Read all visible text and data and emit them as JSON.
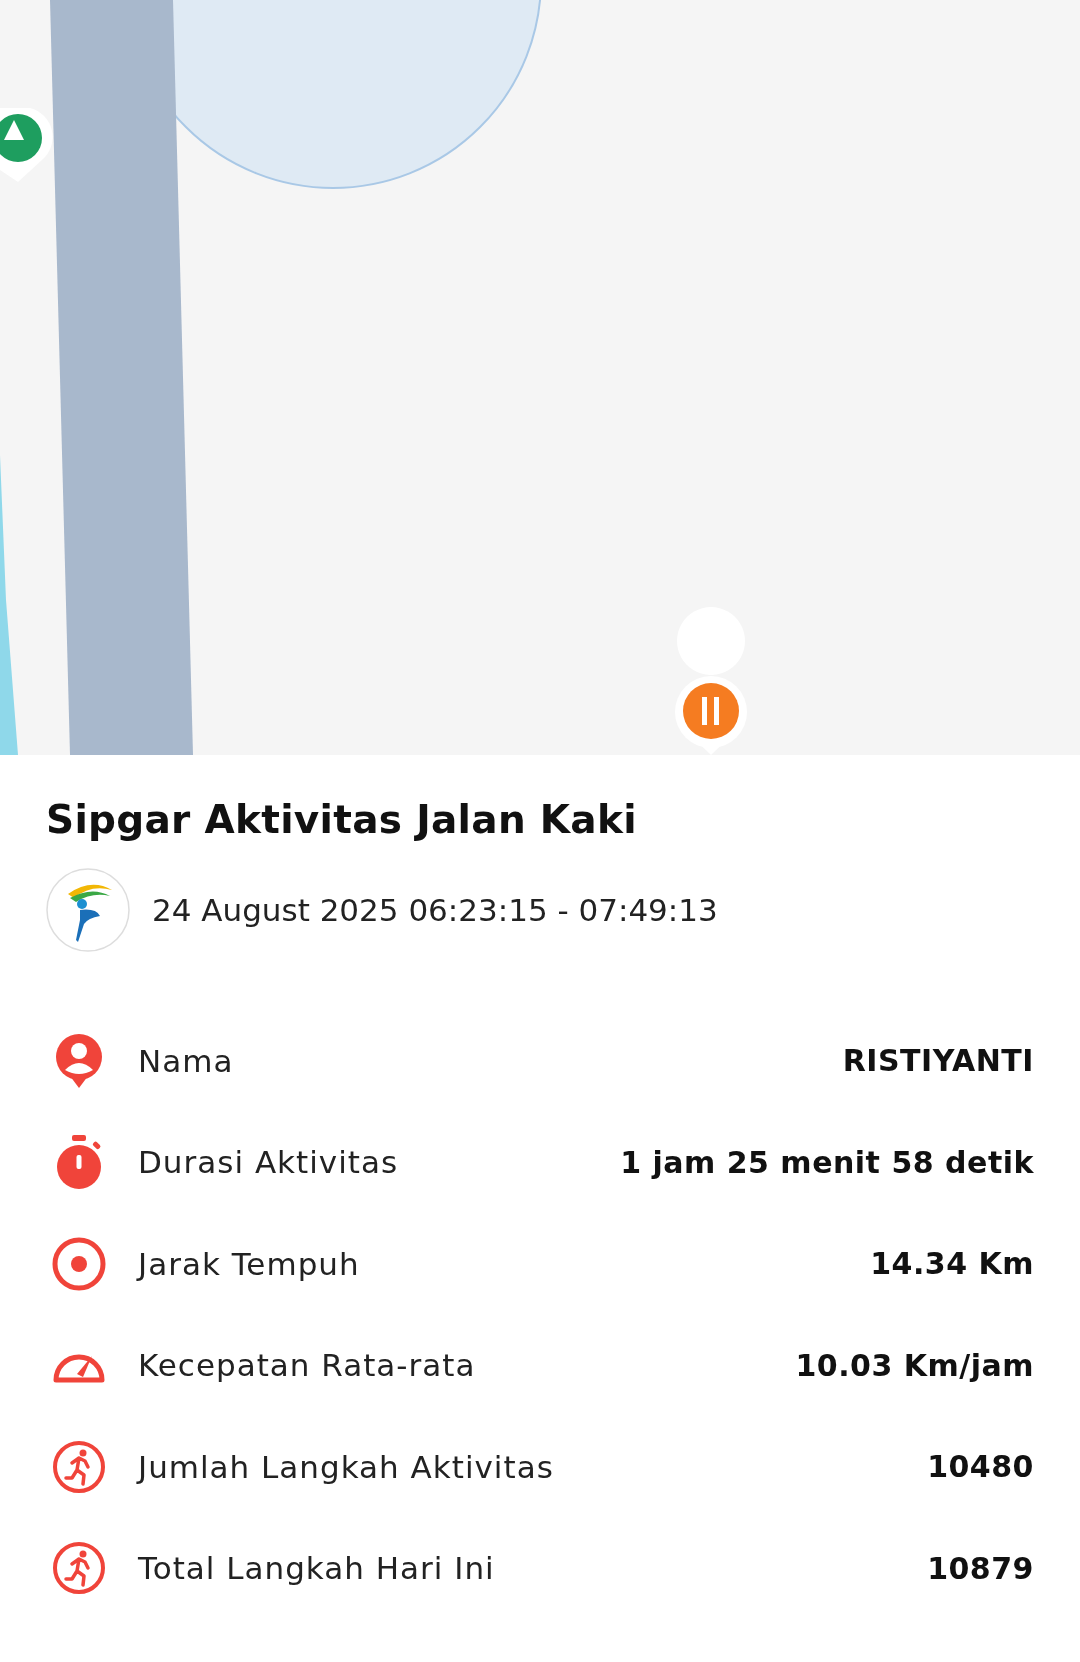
{
  "title": "Sipgar Aktivitas Jalan Kaki",
  "datetime": "24 August 2025 06:23:15 - 07:49:13",
  "stats": [
    {
      "label": "Nama",
      "value": "RISTIYANTI"
    },
    {
      "label": "Durasi Aktivitas",
      "value": "1 jam 25 menit 58 detik"
    },
    {
      "label": "Jarak Tempuh",
      "value": "14.34 Km"
    },
    {
      "label": "Kecepatan Rata-rata",
      "value": "10.03 Km/jam"
    },
    {
      "label": "Jumlah Langkah Aktivitas",
      "value": "10480"
    },
    {
      "label": "Total Langkah Hari Ini",
      "value": "10879"
    }
  ]
}
